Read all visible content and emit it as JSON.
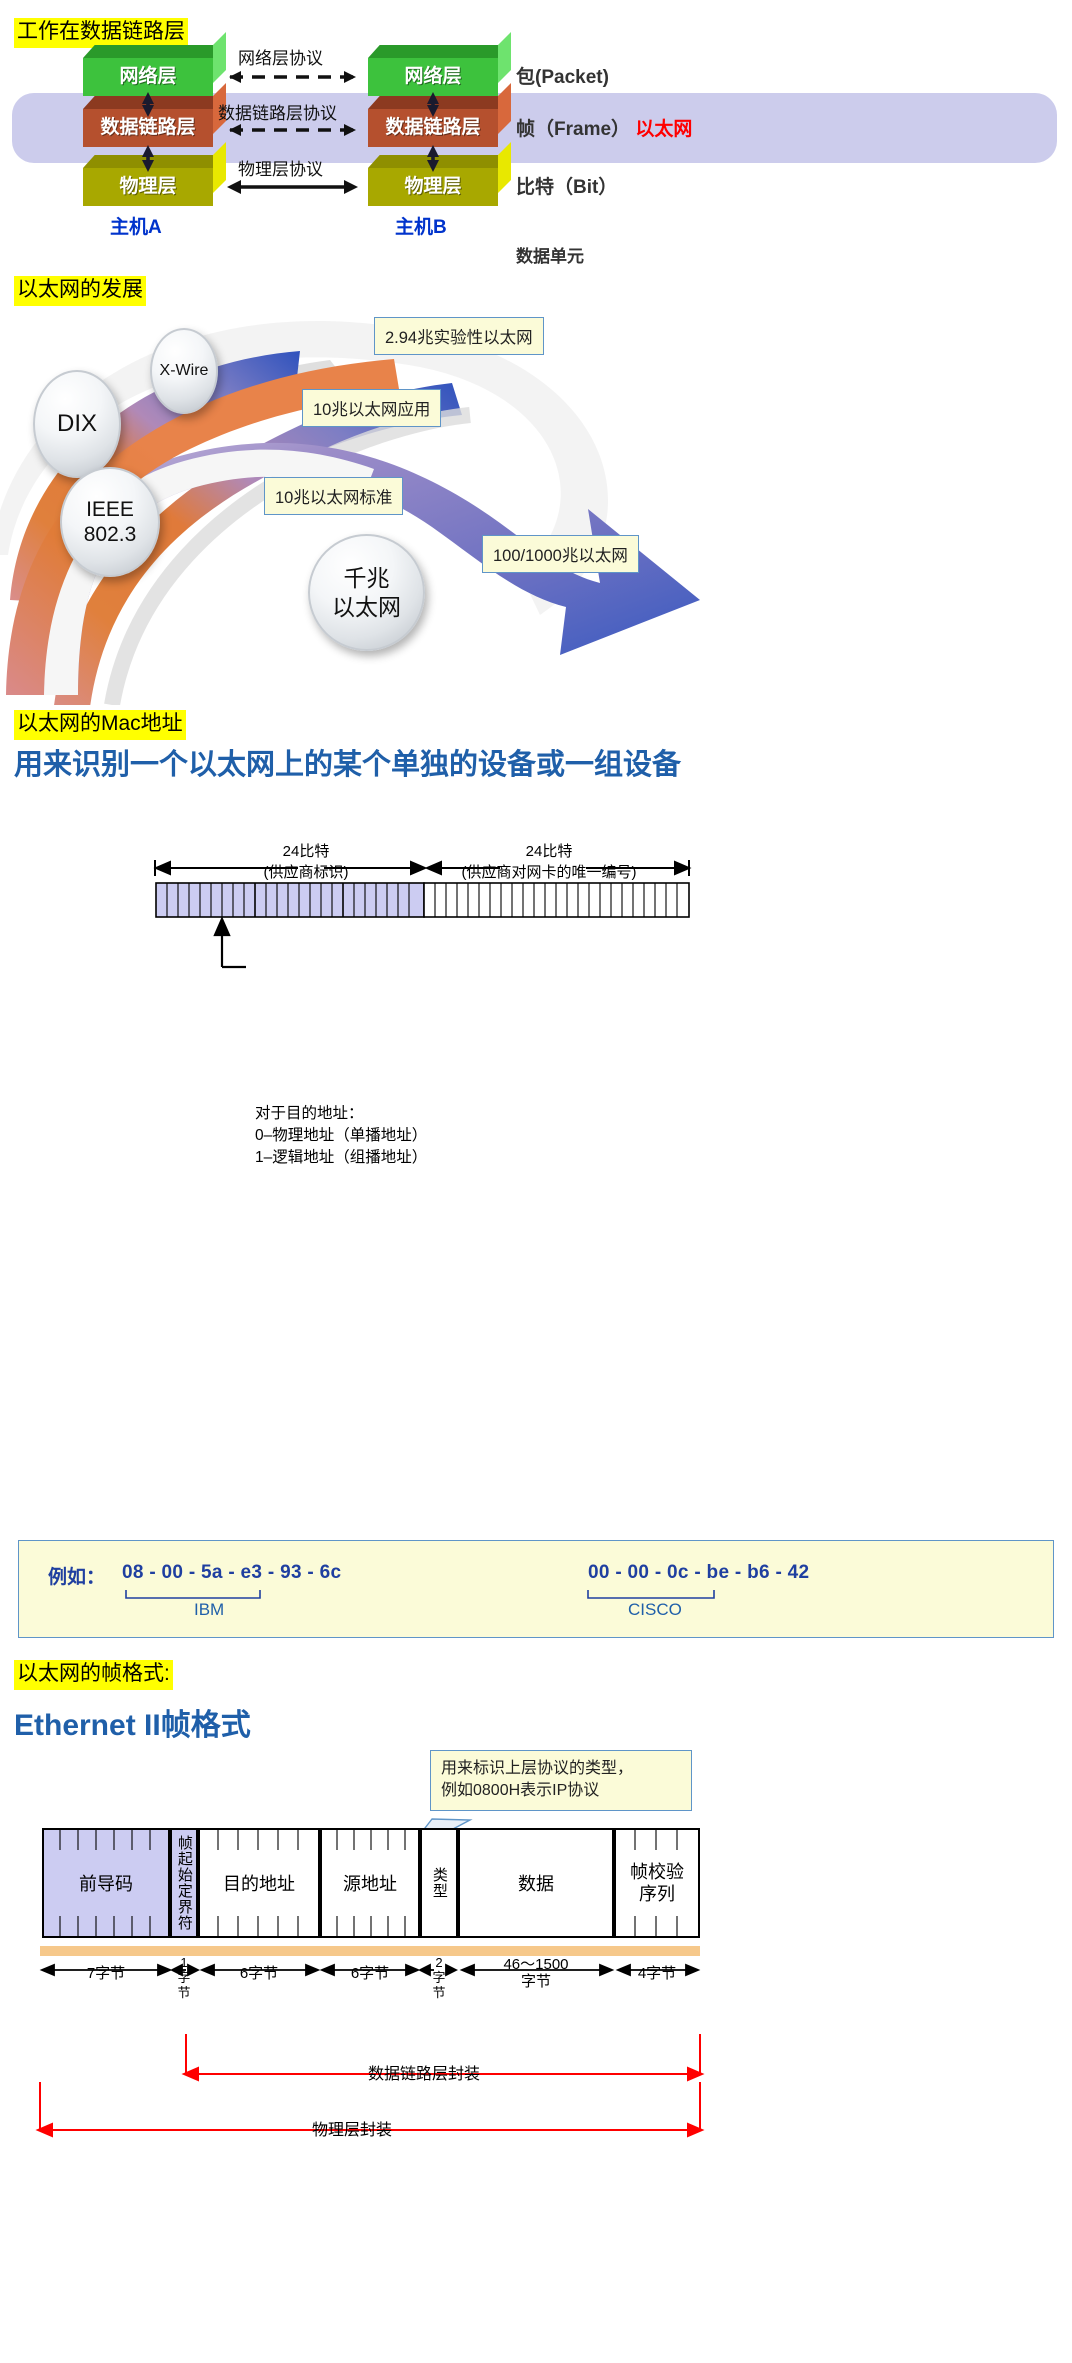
{
  "section1": {
    "heading": "工作在数据链路层",
    "left_layers": [
      {
        "name": "网络层",
        "color": "green"
      },
      {
        "name": "数据链路层",
        "color": "brown"
      },
      {
        "name": "物理层",
        "color": "olive"
      }
    ],
    "right_layers": [
      {
        "name": "网络层",
        "color": "green"
      },
      {
        "name": "数据链路层",
        "color": "brown"
      },
      {
        "name": "物理层",
        "color": "olive"
      }
    ],
    "protocols": [
      "网络层协议",
      "数据链路层协议",
      "物理层协议"
    ],
    "units": [
      "包(Packet)",
      "帧（Frame）",
      "比特（Bit）"
    ],
    "unit_highlight": "以太网",
    "unit_column_label": "数据单元",
    "host_left": "主机A",
    "host_right": "主机B",
    "band_color": "#ccccec"
  },
  "section2": {
    "heading": "以太网的发展",
    "bubbles": [
      {
        "label": "X-Wire"
      },
      {
        "label": "DIX"
      },
      {
        "label": "IEEE\n802.3"
      },
      {
        "label": "千兆\n以太网"
      }
    ],
    "bubble_labels": {
      "xwire": "X-Wire",
      "dix": "DIX",
      "ieee_line1": "IEEE",
      "ieee_line2": "802.3",
      "giga_line1": "千兆",
      "giga_line2": "以太网"
    },
    "callouts": [
      "2.94兆实验性以太网",
      "10兆以太网应用",
      "10兆以太网标准",
      "100/1000兆以太网"
    ],
    "swoosh_colors": {
      "start": "#d98e8e",
      "mid": "#e07a3a",
      "end": "#3b5fc0",
      "purple": "#8b7fc4"
    }
  },
  "section3": {
    "heading": "以太网的Mac地址",
    "subtitle": "用来识别一个以太网上的某个单独的设备或一组设备",
    "left_caption_line1": "24比特",
    "left_caption_line2": "(供应商标识)",
    "right_caption_line1": "24比特",
    "right_caption_line2": "(供应商对网卡的唯一编号)",
    "note_line1": "对于目的地址：",
    "note_line2": "0–物理地址（单播地址）",
    "note_line3": "1–逻辑地址（组播地址）",
    "fill_color": "#ccccf2"
  },
  "section4": {
    "label": "例如：",
    "mac1": "08 - 00 - 5a - e3 - 93 - 6c",
    "mac2": "00 - 00 - 0c - be - b6 - 42",
    "vendor1": "IBM",
    "vendor2": "CISCO"
  },
  "section5": {
    "heading": "以太网的帧格式:",
    "title": "Ethernet II帧格式",
    "tip_line1": "用来标识上层协议的类型，",
    "tip_line2": "例如0800H表示IP协议",
    "fields": [
      {
        "name": "前导码",
        "size": "7字节",
        "vertical": false
      },
      {
        "name": "帧起始定界符",
        "size": "1\n字\n节",
        "vertical": true
      },
      {
        "name": "目的地址",
        "size": "6字节",
        "vertical": false
      },
      {
        "name": "源地址",
        "size": "6字节",
        "vertical": false
      },
      {
        "name": "类型",
        "size": "2\n字\n节",
        "vertical": true
      },
      {
        "name": "数据",
        "size": "46～1500\n字节",
        "vertical": false
      },
      {
        "name": "帧校验\n序列",
        "size": "4字节",
        "vertical": false
      }
    ],
    "field_names": {
      "preamble": "前导码",
      "sfd": "帧起始定界符",
      "dest": "目的地址",
      "src": "源地址",
      "type": "类型",
      "data": "数据",
      "fcs_line1": "帧校验",
      "fcs_line2": "序列"
    },
    "field_sizes": {
      "preamble": "7字节",
      "sfd_line1": "1",
      "sfd_line2": "字",
      "sfd_line3": "节",
      "dest": "6字节",
      "src": "6字节",
      "type_line1": "2",
      "type_line2": "字",
      "type_line3": "节",
      "data_line1": "46～1500",
      "data_line2": "字节",
      "fcs": "4字节"
    },
    "span_datalink": "数据链路层封装",
    "span_physical": "物理层封装",
    "accent_red": "#ff0000",
    "accent_orange": "#f0a030"
  }
}
